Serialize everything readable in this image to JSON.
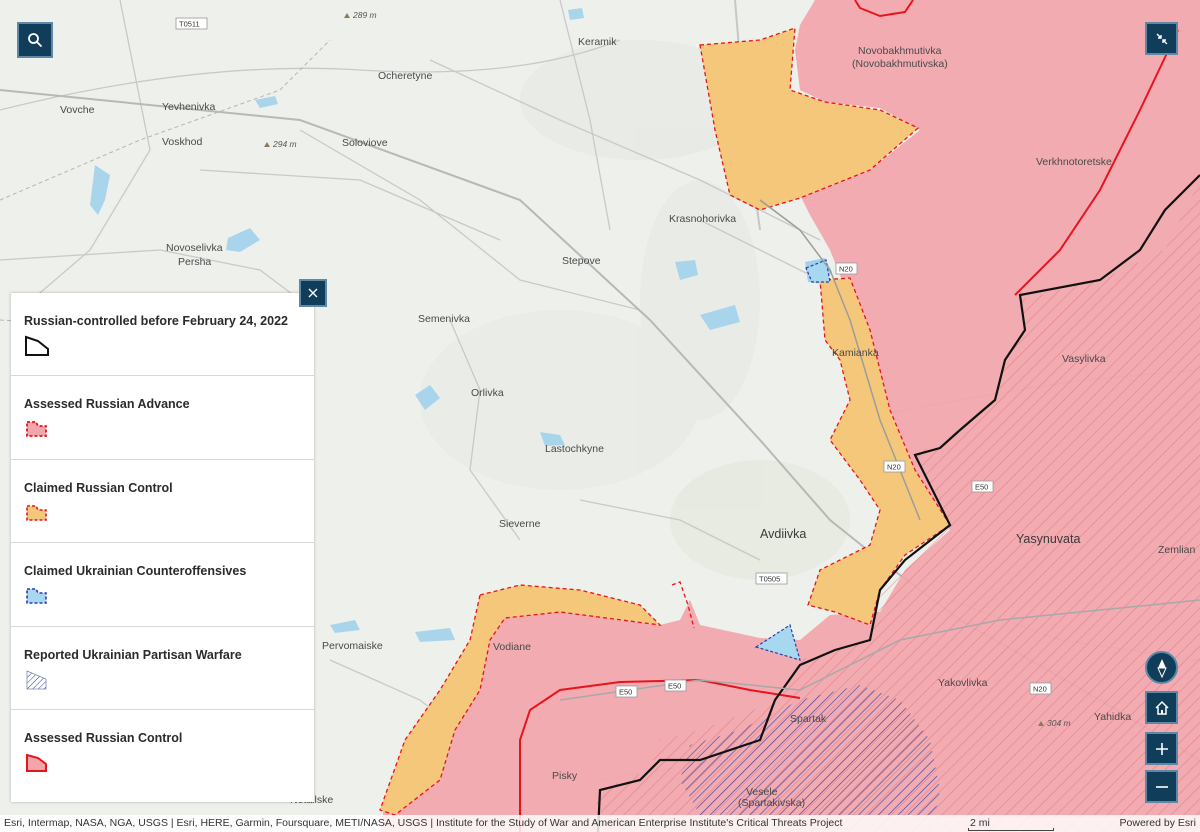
{
  "map": {
    "places": [
      {
        "name": "Keramik",
        "cls": "lbl"
      },
      {
        "name": "Ocheretyne",
        "cls": "lbl"
      },
      {
        "name": "Vovche",
        "cls": "lbl"
      },
      {
        "name": "Yevhenivka",
        "cls": "lbl"
      },
      {
        "name": "Voskhod",
        "cls": "lbl"
      },
      {
        "name": "Soloviove",
        "cls": "lbl"
      },
      {
        "name": "Novoselivka",
        "cls": "lbl"
      },
      {
        "name": "Persha",
        "cls": "lbl"
      },
      {
        "name": "Stepove",
        "cls": "lbl"
      },
      {
        "name": "Krasnohorivka",
        "cls": "lbl"
      },
      {
        "name": "Semenivka",
        "cls": "lbl"
      },
      {
        "name": "Orlivka",
        "cls": "lbl"
      },
      {
        "name": "Lastochkyne",
        "cls": "lbl"
      },
      {
        "name": "Sieverne",
        "cls": "lbl"
      },
      {
        "name": "Avdiivka",
        "cls": "lbl-big"
      },
      {
        "name": "Kamianka",
        "cls": "lbl"
      },
      {
        "name": "Novobakhmutivka",
        "cls": "lbl"
      },
      {
        "name": "(Novobakhmutivska)",
        "cls": "lbl"
      },
      {
        "name": "Verkhnotoretske",
        "cls": "lbl"
      },
      {
        "name": "Vasylivka",
        "cls": "lbl"
      },
      {
        "name": "Yasynuvata",
        "cls": "lbl-big"
      },
      {
        "name": "Zemlian",
        "cls": "lbl"
      },
      {
        "name": "Pervomaiske",
        "cls": "lbl"
      },
      {
        "name": "Vodiane",
        "cls": "lbl"
      },
      {
        "name": "Spartak",
        "cls": "lbl"
      },
      {
        "name": "Yakovlivka",
        "cls": "lbl"
      },
      {
        "name": "Yahidka",
        "cls": "lbl"
      },
      {
        "name": "Pisky",
        "cls": "lbl"
      },
      {
        "name": "Vesele",
        "cls": "lbl"
      },
      {
        "name": "(Spartakivska)",
        "cls": "lbl"
      },
      {
        "name": "Netailske",
        "cls": "lbl"
      }
    ],
    "elevations": [
      "289 m",
      "294 m",
      "304 m"
    ],
    "roads": [
      "T0511",
      "N20",
      "N20",
      "E50",
      "E50",
      "E50",
      "T0505",
      "N20"
    ],
    "colors": {
      "russian_control": "#f2a5ab",
      "claimed_russian": "#f5c77a",
      "claimed_ukrainian": "#a8d8f0",
      "red_line": "#e8141c",
      "water": "#a9d5ec"
    }
  },
  "legend": {
    "items": [
      {
        "title": "Russian-controlled before February 24, 2022",
        "symbol": "black-outline-polygon-icon"
      },
      {
        "title": "Assessed Russian Advance",
        "symbol": "red-dashed-polygon-icon"
      },
      {
        "title": "Claimed Russian Control",
        "symbol": "orange-dashed-polygon-icon"
      },
      {
        "title": "Claimed Ukrainian Counteroffensives",
        "symbol": "blue-dashed-polygon-icon"
      },
      {
        "title": "Reported Ukrainian Partisan Warfare",
        "symbol": "hatched-polygon-icon"
      },
      {
        "title": "Assessed Russian Control",
        "symbol": "red-solid-polygon-icon"
      }
    ]
  },
  "attribution": {
    "text": "Esri, Intermap, NASA, NGA, USGS | Esri, HERE, Garmin, Foursquare, METI/NASA, USGS | Institute for the Study of War and American Enterprise Institute's Critical Threats Project",
    "scale": "2 mi",
    "powered": "Powered by Esri"
  },
  "controls": {
    "search": "search-icon",
    "collapse": "collapse-icon",
    "legend_close": "close-icon",
    "compass": "compass-icon",
    "home": "home-icon",
    "zoom_in": "plus-icon",
    "zoom_out": "minus-icon"
  }
}
